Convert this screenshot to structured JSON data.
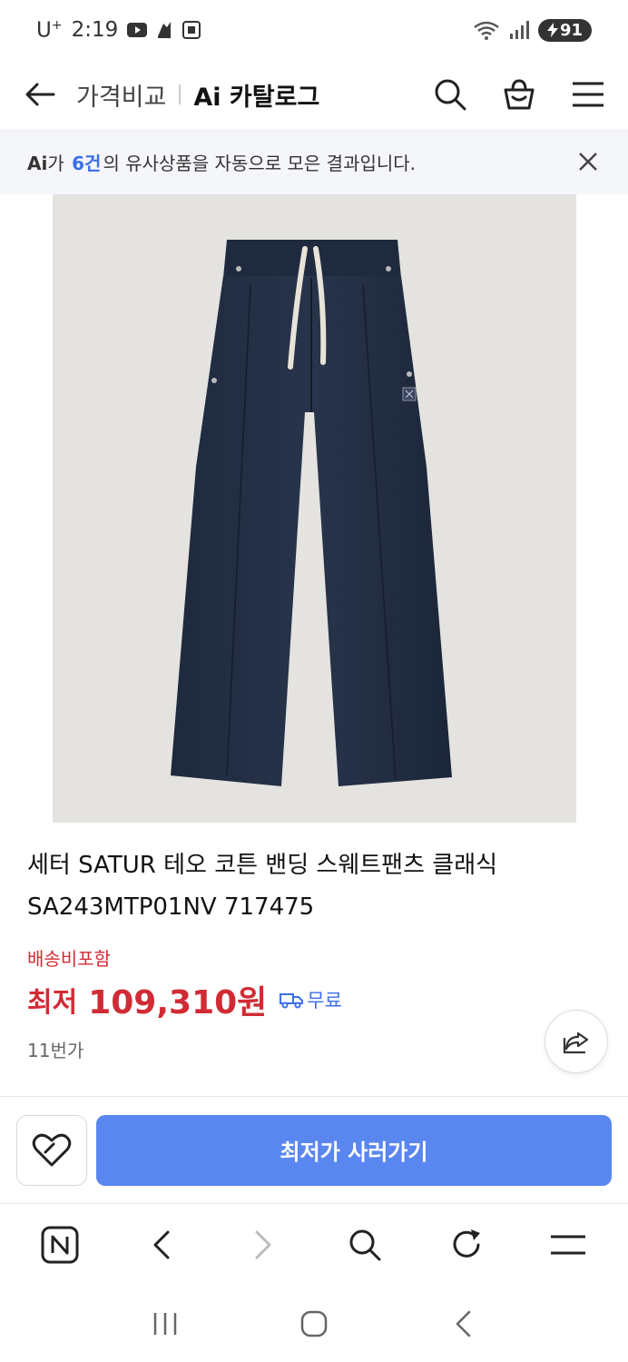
{
  "status_bar": {
    "carrier": "U",
    "carrier_sup": "+",
    "time": "2:19",
    "battery": "91"
  },
  "header": {
    "compare_label": "가격비교",
    "catalog_label": "Ai 카탈로그"
  },
  "notice": {
    "prefix": "Ai",
    "mid": "가 ",
    "count": "6건",
    "suffix": "의 유사상품을 자동으로 모은 결과입니다."
  },
  "product": {
    "title": "세터 SATUR 테오 코튼 밴딩 스웨트팬츠 클래식 SA243MTP01NV 717475",
    "delivery_label": "배송비포함",
    "price_label": "최저",
    "price_value": "109,310원",
    "shipping_label": "무료",
    "seller": "11번가",
    "image_bg_color": "#e4e3df",
    "pants_color": "#232f45"
  },
  "actions": {
    "buy_label": "최저가 사러가기",
    "buy_color": "#5a86f0"
  },
  "colors": {
    "accent_red": "#d12b35",
    "accent_blue": "#3b6ee8"
  }
}
